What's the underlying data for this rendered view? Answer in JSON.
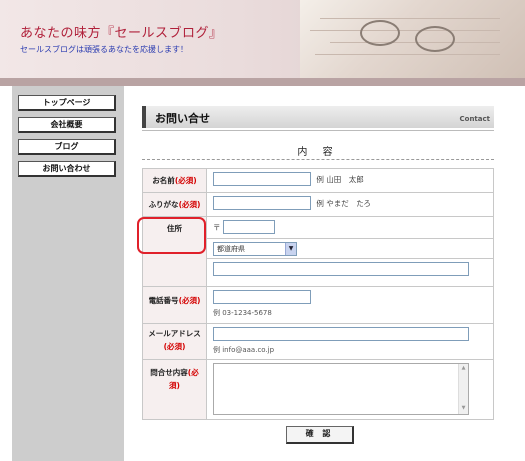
{
  "header": {
    "title": "あなたの味方『セールスブログ』",
    "subtitle": "セールスブログは頑張るあなたを応援します！"
  },
  "sidebar": {
    "items": [
      {
        "label": "トップページ"
      },
      {
        "label": "会社概要"
      },
      {
        "label": "ブログ"
      },
      {
        "label": "お問い合わせ"
      }
    ]
  },
  "main": {
    "heading": "お問い合せ",
    "heading_en": "Contact",
    "section_title": "内 容"
  },
  "form": {
    "required_mark": "(必須)",
    "name": {
      "label": "お名前",
      "hint": "例 山田　太郎"
    },
    "furigana": {
      "label": "ふりがな",
      "hint": "例 やまだ　たろ"
    },
    "address": {
      "label": "住所",
      "postal_mark": "〒",
      "prefecture_selected": "都道府県"
    },
    "phone": {
      "label": "電話番号",
      "hint": "例 03-1234-5678"
    },
    "email": {
      "label": "メールアドレス",
      "hint": "例 info@aaa.co.jp"
    },
    "inquiry": {
      "label": "問合せ内容"
    },
    "submit_label": "確 認"
  }
}
